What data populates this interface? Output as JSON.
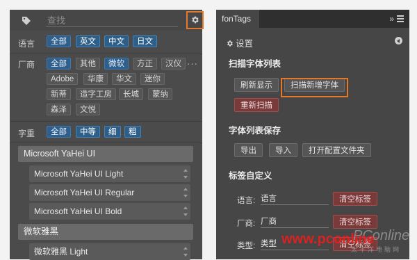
{
  "left": {
    "search": {
      "placeholder": "查找"
    },
    "rows": {
      "language": {
        "label": "语言",
        "chips": [
          "全部",
          "英文",
          "中文",
          "日文"
        ]
      },
      "vendor": {
        "label": "厂商",
        "chips": [
          "全部",
          "其他",
          "微软",
          "方正",
          "汉仪",
          "Adobe",
          "华康",
          "华文",
          "迷你",
          "新蒂",
          "造字工房",
          "长城",
          "蒙纳",
          "森泽",
          "文悦"
        ],
        "more": "···"
      },
      "weight": {
        "label": "字重",
        "chips": [
          "全部",
          "中等",
          "细",
          "粗"
        ]
      }
    },
    "fonts": {
      "group1": "Microsoft YaHei UI",
      "items1": [
        "Microsoft YaHei UI Light",
        "Microsoft YaHei UI Regular",
        "Microsoft YaHei UI Bold"
      ],
      "group2": "微软雅黑",
      "items2": [
        "微软雅黑 Light"
      ]
    }
  },
  "right": {
    "tab_title": "fonTags",
    "tab_arrows": "»",
    "settings_label": "设置",
    "scan": {
      "title": "扫描字体列表",
      "refresh": "刷新显示",
      "scan_new": "扫描新增字体",
      "rescan": "重新扫描"
    },
    "save": {
      "title": "字体列表保存",
      "export": "导出",
      "import": "导入",
      "open_config": "打开配置文件夹"
    },
    "tags": {
      "title": "标签自定义",
      "fields": [
        {
          "label": "语言:",
          "value": "语言",
          "clear": "清空标签"
        },
        {
          "label": "厂商:",
          "value": "厂商",
          "clear": "清空标签"
        },
        {
          "label": "类型:",
          "value": "类型",
          "clear": "清空标签"
        }
      ]
    }
  },
  "watermark": {
    "main": "www.pconline",
    "sub": "太平洋电脑网",
    "logo": "PConline"
  },
  "colors": {
    "highlight": "#e4782c",
    "selected": "#2f5f8a",
    "danger": "#7a3a3a"
  }
}
